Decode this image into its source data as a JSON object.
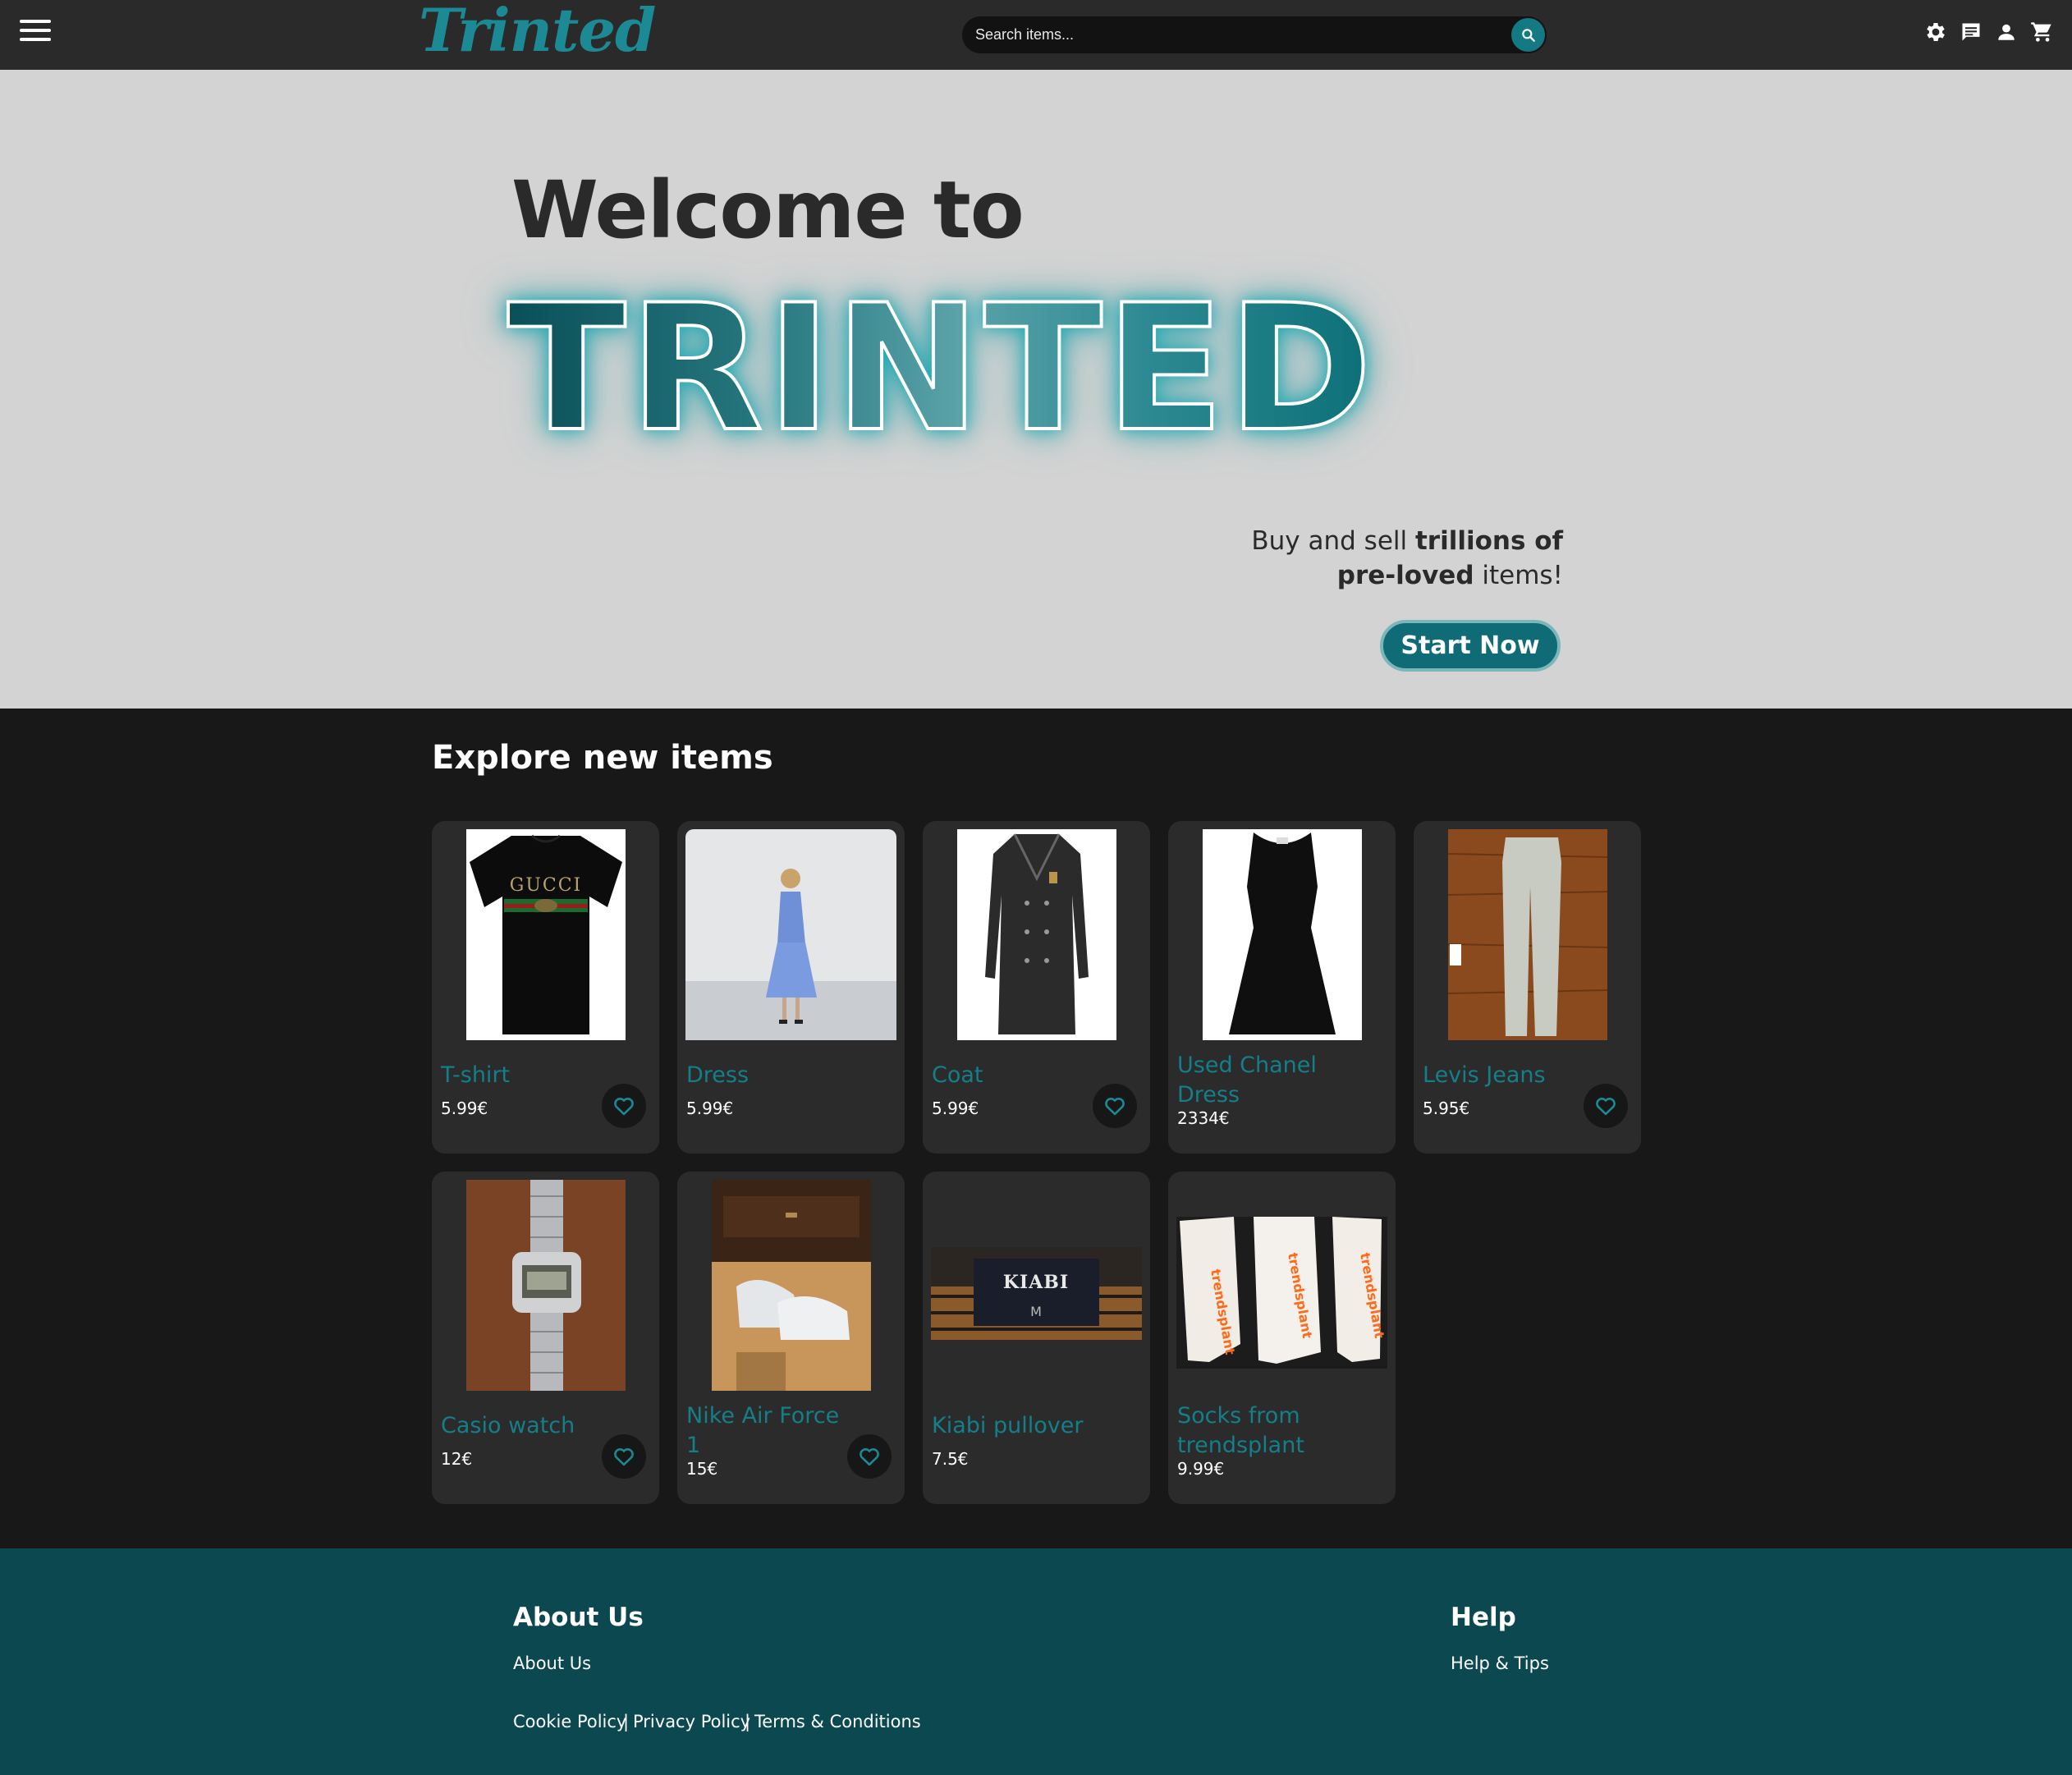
{
  "header": {
    "logo": "Trinted",
    "search_placeholder": "Search items...",
    "icons": [
      "menu-icon",
      "search-icon",
      "gear-icon",
      "chat-icon",
      "person-icon",
      "cart-icon"
    ]
  },
  "hero": {
    "welcome": "Welcome to",
    "brand": "TRINTED",
    "tagline_part1": "Buy and sell ",
    "tagline_bold1": "trillions of",
    "tagline_bold2": "pre-loved",
    "tagline_part2": " items!",
    "cta": "Start Now"
  },
  "explore": {
    "title": "Explore new items",
    "items": [
      {
        "name": "T-shirt",
        "price": "5.99€",
        "liked": false
      },
      {
        "name": "Dress",
        "price": "5.99€",
        "liked": false
      },
      {
        "name": "Coat",
        "price": "5.99€",
        "liked": false
      },
      {
        "name": "Used Chanel Dress",
        "price": "2334€",
        "liked": false
      },
      {
        "name": "Levis Jeans",
        "price": "5.95€",
        "liked": false
      },
      {
        "name": "Casio watch",
        "price": "12€",
        "liked": false
      },
      {
        "name": "Nike Air Force 1",
        "price": "15€",
        "liked": false
      },
      {
        "name": "Kiabi pullover",
        "price": "7.5€",
        "liked": false
      },
      {
        "name": "Socks from trendsplant",
        "price": "9.99€",
        "liked": false
      }
    ],
    "image_labels": {
      "gucci": "GUCCI",
      "kiabi": "KIABI",
      "kiabi_size": "M",
      "trendsplant": "trendsplant"
    }
  },
  "footer": {
    "about_heading": "About Us",
    "about_link": "About Us",
    "cookie": "Cookie Policy",
    "privacy": "Privacy Policy",
    "terms": "Terms & Conditions",
    "separator": "|",
    "help_heading": "Help",
    "help_link": "Help & Tips"
  },
  "colors": {
    "accent": "#137983",
    "header_bg": "#2a2a2a",
    "hero_bg": "#d3d3d3",
    "page_bg": "#181818",
    "card_bg": "#2b2b2b",
    "footer_bg": "#0b4850"
  }
}
